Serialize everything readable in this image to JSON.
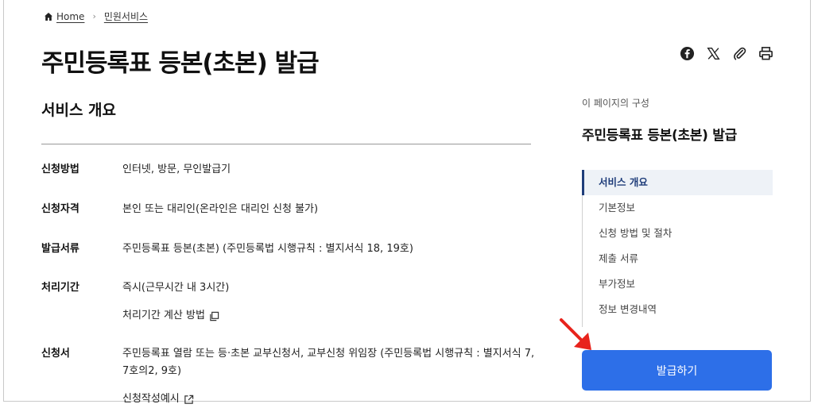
{
  "breadcrumb": {
    "home": "Home",
    "current": "민원서비스"
  },
  "page_title": "주민등록표 등본(초본) 발급",
  "section_title": "서비스 개요",
  "rows": [
    {
      "label": "신청방법",
      "value": "인터넷, 방문, 무인발급기"
    },
    {
      "label": "신청자격",
      "value": "본인 또는 대리인(온라인은 대리인 신청 불가)"
    },
    {
      "label": "발급서류",
      "value": "주민등록표 등본(초본) (주민등록법 시행규칙 : 별지서식 18, 19호)"
    },
    {
      "label": "처리기간",
      "value": "즉시(근무시간 내 3시간)",
      "link": "처리기간 계산 방법"
    },
    {
      "label": "신청서",
      "value": "주민등록표 열람 또는 등·초본 교부신청서, 교부신청 위임장 (주민등록법 시행규칙 : 별지서식 7, 7호의2, 9호)",
      "link": "신청작성예시"
    }
  ],
  "toc": {
    "caption": "이 페이지의 구성",
    "title": "주민등록표 등본(초본) 발급",
    "items": [
      "서비스 개요",
      "기본정보",
      "신청 방법 및 절차",
      "제출 서류",
      "부가정보",
      "정보 변경내역"
    ],
    "active_index": 0
  },
  "issue_button": "발급하기",
  "share_icons": [
    "facebook-icon",
    "x-icon",
    "paperclip-icon",
    "print-icon"
  ],
  "colors": {
    "primary_button": "#2d6fe8",
    "toc_active": "#1f3d7a",
    "arrow": "#e8231c"
  }
}
